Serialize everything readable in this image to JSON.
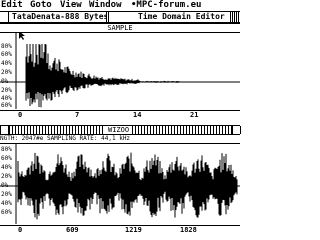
{
  "menu": {
    "items": [
      "Edit",
      "Goto",
      "View",
      "Window",
      "•MPC-forum.eu"
    ]
  },
  "titlebar": {
    "file_label": "TataDenata-888 Bytes",
    "editor_label": "Time Domain Editor"
  },
  "top_panel": {
    "title": "SAMPLE",
    "y_ticks": [
      "80%",
      "60%",
      "40%",
      "20%",
      "0%",
      "20%",
      "40%",
      "60%",
      "80%"
    ],
    "x_ticks": [
      "0",
      "7",
      "14",
      "21"
    ]
  },
  "bottom_panel": {
    "title": "WIZOO",
    "info": "NGTH: 2047#e   SAMPLING RATE: 44,1 kHz",
    "y_ticks": [
      "80%",
      "60%",
      "40%",
      "20%",
      "0%",
      "20%",
      "40%",
      "60%",
      "80%"
    ],
    "x_ticks": [
      "0",
      "609",
      "1219",
      "1828"
    ]
  },
  "colors": {
    "foreground": "#000000",
    "background": "#ffffff"
  }
}
